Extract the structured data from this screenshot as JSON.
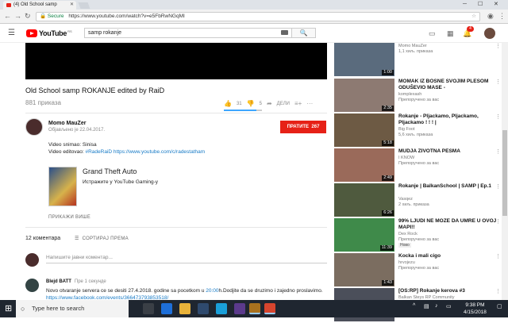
{
  "browser": {
    "tab_title": "(4) Old School samp",
    "secure_label": "Secure",
    "url": "https://www.youtube.com/watch?v=e5FbRwNGqMI"
  },
  "header": {
    "logo_text": "YouTube",
    "logo_region": "RS",
    "search_value": "samp rokanje",
    "notification_count": "4"
  },
  "video": {
    "title": "Old School samp ROKANJE edited by RaiD",
    "views": "881 приказа",
    "likes": "31",
    "dislikes": "5",
    "share_label": "ДЕЛИ",
    "like_ratio": 0.86
  },
  "channel": {
    "name": "Momo MauZer",
    "published": "Објављено је 22.04.2017.",
    "subscribe_label": "ПРАТИТЕ",
    "subscriber_count": "267"
  },
  "description": {
    "line1": "Video snimao: Sinisa",
    "line2_prefix": "Video editovao: ",
    "hashtag": "#RadeRaiD",
    "link": "https://www.youtube.com/c/radestatham",
    "game_title": "Grand Theft Auto",
    "game_sub": "Истражите у YouTube Gaming-у",
    "show_more": "ПРИКАЖИ ВИШЕ"
  },
  "comments": {
    "count_label": "12 коментара",
    "sort_label": "СОРТИРАЈ ПРЕМА",
    "input_placeholder": "Напишите јавни коментар...",
    "first": {
      "author": "Blejd BATT",
      "time": "Пре 1 секунде",
      "text_pre": "Novo otvaranje servera ce se desiti 27.4.2018. godine sa pocetkom u ",
      "time_link": "20:00",
      "text_post": "h.Dodjite da se druzimo i zajedno proslavimo.",
      "url": "https://www.facebook.com/events/366473793853518/"
    }
  },
  "related": [
    {
      "title": "",
      "channel": "Momo MauZer",
      "meta": "1,1 хиљ. приказа",
      "duration": "1:00",
      "color": "#5a6b7d"
    },
    {
      "title": "MOMAK IZ BOSNE SVOJIM PLESOM ODUŠEVIO MASE -",
      "channel": "komplexash",
      "meta": "Препоручено за вас",
      "duration": "2:35",
      "color": "#8d7a72"
    },
    {
      "title": "Rokanje - Pljackamo, Pljackamo, Pljackamo ! ! ! |",
      "channel": "Big Foot",
      "meta": "5,6 хиљ. приказа",
      "duration": "5:18",
      "color": "#6d5a44"
    },
    {
      "title": "MUDJA ZIVOTNA PESMA",
      "channel": "I KNOW",
      "meta": "Препоручено за вас",
      "duration": "2:49",
      "color": "#9a6a5a"
    },
    {
      "title": "Rokanje | BalkanSchool | SAMP | Ep.1",
      "channel": "Vasqez",
      "meta": "2 хиљ. приказа",
      "duration": "6:26",
      "color": "#4f5a3e"
    },
    {
      "title": "99% LJUDI NE MOZE DA UMRE U OVOJ MAPI!!",
      "channel": "Dex Rock",
      "meta": "Препоручено за вас",
      "badge": "Ново",
      "duration": "11:39",
      "color": "#3f8a4a"
    },
    {
      "title": "Kocka i mali cigo",
      "channel": "hrvojezu",
      "meta": "Препоручено за вас",
      "duration": "1:43",
      "color": "#7b6d60"
    },
    {
      "title": "[OS:RP] Rokanje kerova #3",
      "channel": "Balkan Steys RP Community",
      "meta": "",
      "duration": "",
      "color": "#4b4f5a"
    }
  ],
  "taskbar": {
    "search_placeholder": "Type here to search",
    "time": "9:38 PM",
    "date": "4/15/2018"
  },
  "colors": {
    "brand": "#e62117",
    "link": "#167ac6"
  }
}
